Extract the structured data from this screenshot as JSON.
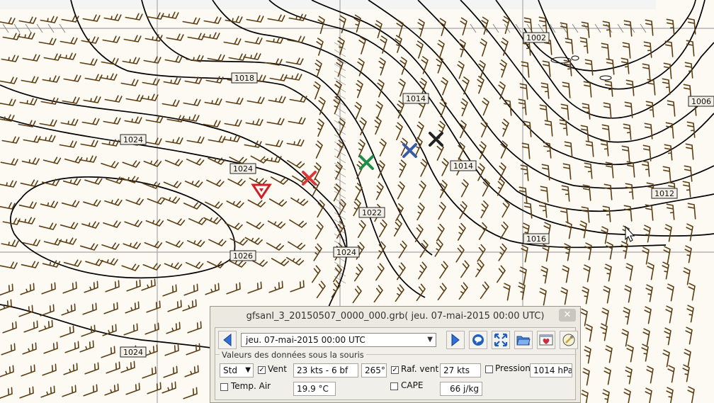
{
  "map": {
    "isobar_labels": [
      "1018",
      "1024",
      "1024",
      "1026",
      "1024",
      "1022",
      "1024",
      "1014",
      "1014",
      "1002",
      "1006",
      "1012",
      "1016"
    ],
    "colors": {
      "isobar": "#000000",
      "wind_barb": "#5b3e12",
      "grid": "#a8a8a8",
      "background": "#fdf9f3",
      "marker_red": "#d9383a",
      "marker_green": "#1e8f4a",
      "marker_blue": "#3a5aa6",
      "marker_black": "#222222"
    },
    "icons": [
      "red-cross-marker-icon",
      "green-cross-marker-icon",
      "blue-cross-marker-icon",
      "black-cross-marker-icon",
      "red-triangle-marker-icon",
      "mouse-cursor-icon"
    ]
  },
  "panel": {
    "title": "gfsanl_3_20150507_0000_000.grb( jeu. 07-mai-2015 00:00  UTC)",
    "close_glyph": "✕",
    "date_value": "jeu. 07-mai-2015 00:00  UTC",
    "group_title": "Valeurs des données sous la souris",
    "altitude_select": "Std",
    "wind_label": "Vent",
    "wind_checked": true,
    "wind_value": "23 kts -  6 bf",
    "wind_dir": "265°",
    "gust_label": "Raf. vent",
    "gust_checked": true,
    "gust_value": "27 kts",
    "pressure_label": "Pression",
    "pressure_checked": false,
    "pressure_value": "1014 hPa",
    "temp_label": "Temp. Air",
    "temp_checked": false,
    "temp_value": "19.9 °C",
    "cape_label": "CAPE",
    "cape_checked": false,
    "cape_value": "66 j/kg",
    "toolbar_icons": [
      "prev-arrow-icon",
      "next-arrow-icon",
      "chat-bubble-icon",
      "fit-extent-icon",
      "open-folder-icon",
      "favorites-icon",
      "preferences-icon"
    ]
  }
}
